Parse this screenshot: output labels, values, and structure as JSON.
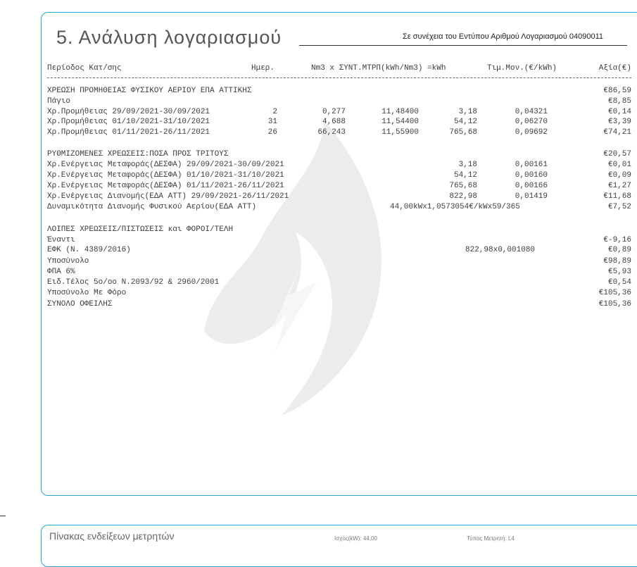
{
  "page": {
    "title": "5.  Ανάλυση λογαριασμού",
    "subtitle": "Σε συνέχεια του Εντύπου Αριθμού Λογαριασμού 04090011"
  },
  "headers": {
    "period": "Περίοδος Κατ/σης",
    "days": "Ημερ.",
    "nm3": "Nm3 x ΣΥΝΤ.ΜΤΡΠ(kWh/Nm3) =kWh",
    "unit_price": "Τιμ.Μον.(€/kWh)",
    "value": "Αξία(€)"
  },
  "section1": {
    "heading": "ΧΡΕΩΣΗ ΠΡΟΜΗΘΕΙΑΣ ΦΥΣΙΚΟΥ ΑΕΡΙΟΥ ΕΠΑ ΑΤΤΙΚΗΣ",
    "total": "€86,59",
    "fixed_label": "Πάγιο",
    "fixed_value": "€8,85",
    "rows": [
      {
        "label": "Χρ.Προμήθειας 29/09/2021-30/09/2021",
        "days": "2",
        "nm3": "0,277",
        "coef": "11,48400",
        "kwh": "3,18",
        "price": "0,04321",
        "value": "€0,14"
      },
      {
        "label": "Χρ.Προμήθειας 01/10/2021-31/10/2021",
        "days": "31",
        "nm3": "4,688",
        "coef": "11,54400",
        "kwh": "54,12",
        "price": "0,06270",
        "value": "€3,39"
      },
      {
        "label": "Χρ.Προμήθειας 01/11/2021-26/11/2021",
        "days": "26",
        "nm3": "66,243",
        "coef": "11,55900",
        "kwh": "765,68",
        "price": "0,09692",
        "value": "€74,21"
      }
    ]
  },
  "section2": {
    "heading": "ΡΥΘΜΙΖΟΜΕΝΕΣ ΧΡΕΩΣΕΙΣ:ΠΟΣΑ ΠΡΟΣ ΤΡΙΤΟΥΣ",
    "total": "€20,57",
    "rows": [
      {
        "label": "Χρ.Ενέργειας Μεταφοράς(ΔΕΣΦΑ) 29/09/2021-30/09/2021",
        "kwh": "3,18",
        "price": "0,00161",
        "value": "€0,01"
      },
      {
        "label": "Χρ.Ενέργειας Μεταφοράς(ΔΕΣΦΑ) 01/10/2021-31/10/2021",
        "kwh": "54,12",
        "price": "0,00160",
        "value": "€0,09"
      },
      {
        "label": "Χρ.Ενέργειας Μεταφοράς(ΔΕΣΦΑ) 01/11/2021-26/11/2021",
        "kwh": "765,68",
        "price": "0,00166",
        "value": "€1,27"
      },
      {
        "label": "Χρ.Ενέργειας Διανομής(ΕΔΑ ΑΤΤ) 29/09/2021-26/11/2021",
        "kwh": "822,98",
        "price": "0,01419",
        "value": "€11,68"
      }
    ],
    "capacity_label": "Δυναμικότητα Διανομής Φυσικού Αερίου(ΕΔΑ ΑΤΤ)",
    "capacity_calc": "44,00kWx1,0573054€/kWx59/365",
    "capacity_value": "€7,52"
  },
  "section3": {
    "heading": "ΛΟΙΠΕΣ ΧΡΕΩΣΕΙΣ/ΠΙΣΤΩΣΕΙΣ και ΦΟΡΟΙ/ΤΕΛΗ",
    "rows": [
      {
        "label": "Έναντι",
        "calc": "",
        "value": "€-9,16"
      },
      {
        "label": "ΕΦΚ (Ν. 4389/2016)",
        "calc": "822,98x0,001080",
        "value": "€0,89"
      },
      {
        "label": "Υποσύνολο",
        "calc": "",
        "value": "€98,89"
      },
      {
        "label": "ΦΠΑ 6%",
        "calc": "",
        "value": "€5,93"
      },
      {
        "label": "Ειδ.Τέλος 5ο/οο Ν.2093/92 & 2960/2001",
        "calc": "",
        "value": "€0,54"
      },
      {
        "label": "Υποσύνολο Με Φόρο",
        "calc": "",
        "value": "€105,36"
      },
      {
        "label": "ΣΥΝΟΛΟ ΟΦΕΙΛΗΣ",
        "calc": "",
        "value": "€105,36"
      }
    ]
  },
  "panel2": {
    "title": "Πίνακας ενδείξεων μετρητών",
    "power": "Ισχύς(kW): 44,00",
    "meter_type": "Τύπος Μετρητή: L4"
  },
  "colors": {
    "border": "#29a6d6",
    "watermark": "#e9e9e9"
  }
}
